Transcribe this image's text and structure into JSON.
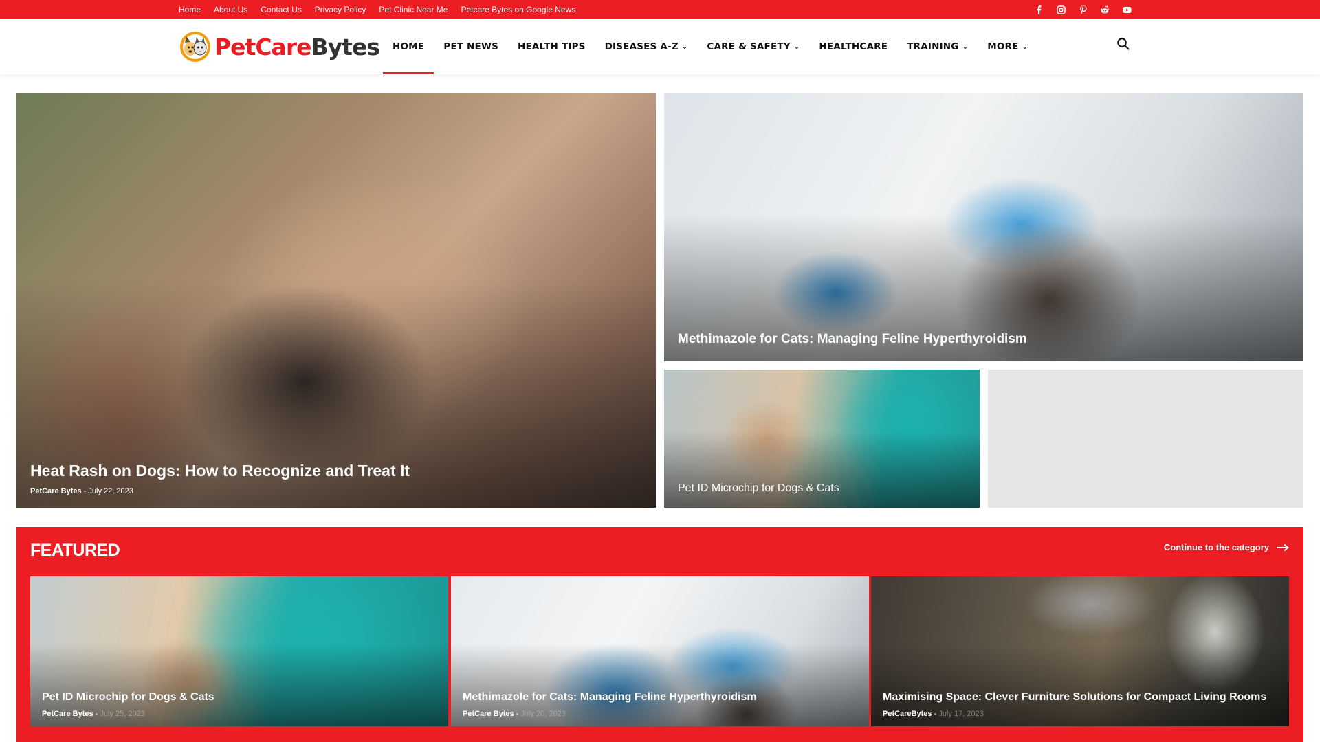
{
  "topbar": {
    "links": [
      "Home",
      "About Us",
      "Contact Us",
      "Privacy Policy",
      "Pet Clinic Near Me",
      "Petcare Bytes on Google News"
    ],
    "social_icons": [
      "facebook-icon",
      "instagram-icon",
      "pinterest-icon",
      "reddit-icon",
      "youtube-icon"
    ]
  },
  "header": {
    "logo_part1": "PetCare",
    "logo_part2": "Bytes",
    "nav": [
      {
        "label": "HOME",
        "active": true,
        "dropdown": false
      },
      {
        "label": "PET NEWS",
        "active": false,
        "dropdown": false
      },
      {
        "label": "HEALTH TIPS",
        "active": false,
        "dropdown": false
      },
      {
        "label": "DISEASES A-Z",
        "active": false,
        "dropdown": true
      },
      {
        "label": "CARE & SAFETY",
        "active": false,
        "dropdown": true
      },
      {
        "label": "HEALTHCARE",
        "active": false,
        "dropdown": false
      },
      {
        "label": "TRAINING",
        "active": false,
        "dropdown": true
      },
      {
        "label": "MORE",
        "active": false,
        "dropdown": true
      }
    ],
    "search_icon": "search-icon"
  },
  "hero": {
    "main": {
      "title": "Heat Rash on Dogs: How to Recognize and Treat It",
      "author": "PetCare Bytes",
      "date": "July 22, 2023"
    },
    "top_right": {
      "title": "Methimazole for Cats: Managing Feline Hyperthyroidism"
    },
    "bottom_left": {
      "title": "Pet ID Microchip for Dogs & Cats"
    }
  },
  "featured": {
    "heading": "FEATURED",
    "more_label": "Continue to the category",
    "cards": [
      {
        "title": "Pet ID Microchip for Dogs & Cats",
        "author": "PetCare Bytes",
        "date": "July 25, 2023"
      },
      {
        "title": "Methimazole for Cats: Managing Feline Hyperthyroidism",
        "author": "PetCare Bytes",
        "date": "July 20, 2023"
      },
      {
        "title": "Maximising Space: Clever Furniture Solutions for Compact Living Rooms",
        "author": "PetCareBytes",
        "date": "July 17, 2023"
      }
    ]
  },
  "colors": {
    "brand": "#ed1d24",
    "text": "#111111"
  }
}
